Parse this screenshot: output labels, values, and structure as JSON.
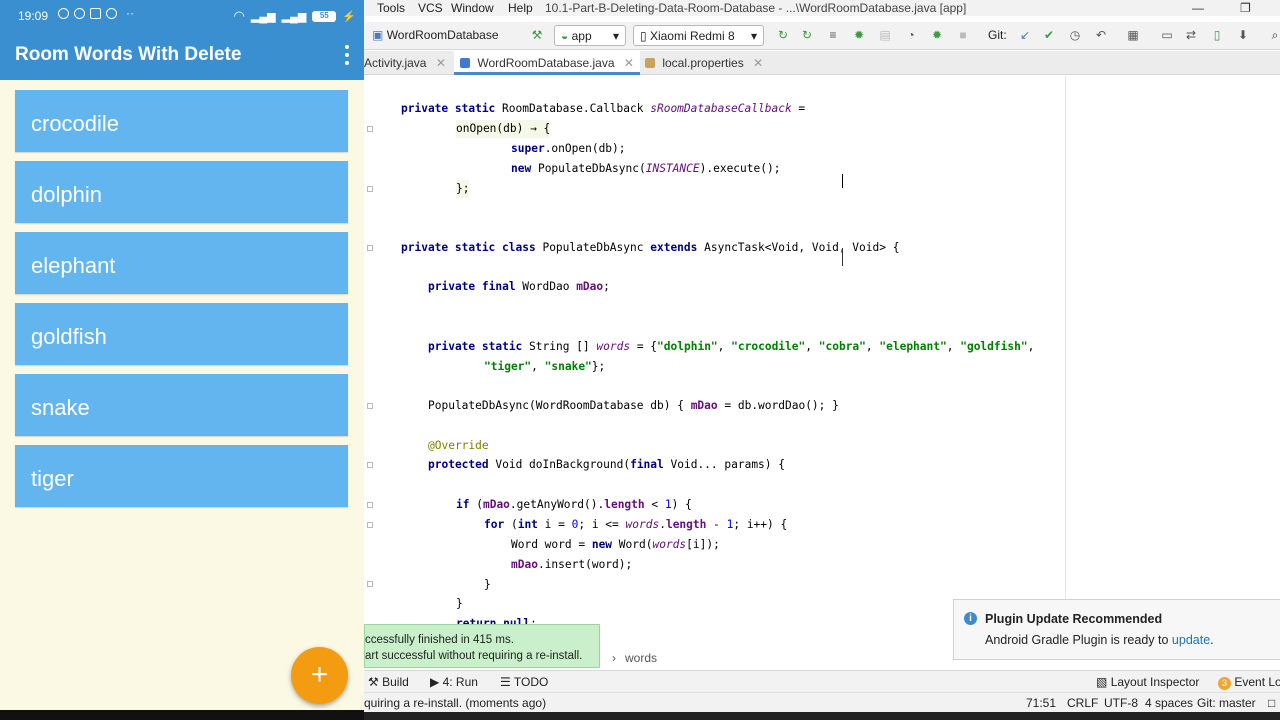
{
  "phone": {
    "status_time": "19:09",
    "status_dots": "··",
    "battery": "55",
    "app_title": "Room Words With Delete",
    "words": [
      "crocodile",
      "dolphin",
      "elephant",
      "goldfish",
      "snake",
      "tiger"
    ],
    "fab_label": "+",
    "colors": {
      "app_bar": "#3a8fd1",
      "list_item": "#63b5f0",
      "background": "#fbf8e4",
      "fab": "#f39c12"
    }
  },
  "ide": {
    "menu": [
      "Tools",
      "VCS",
      "Window",
      "Help"
    ],
    "window_title": "10.1-Part-B-Deleting-Data-Room-Database - ...\\WordRoomDatabase.java [app]",
    "toolbar": {
      "crumb": "WordRoomDatabase",
      "run_config": "app",
      "device": "Xiaomi Redmi 8",
      "git_label": "Git:"
    },
    "tabs": [
      {
        "label": "Activity.java",
        "active": false
      },
      {
        "label": "WordRoomDatabase.java",
        "active": true
      },
      {
        "label": "local.properties",
        "active": false
      }
    ],
    "code": {
      "l1_a": "private static ",
      "l1_b": "RoomDatabase.Callback ",
      "l1_c": "sRoomDatabaseCallback",
      "l1_d": " =",
      "l2": "onOpen(db) → {",
      "l3_a": "super",
      "l3_b": ".onOpen(db);",
      "l4_a": "new ",
      "l4_b": "PopulateDbAsync(",
      "l4_c": "INSTANCE",
      "l4_d": ").execute();",
      "l5": "};",
      "l6_a": "private static class ",
      "l6_b": "PopulateDbAsync ",
      "l6_c": "extends ",
      "l6_d": "AsyncTask<Void, Void, Void> {",
      "l7_a": "private final ",
      "l7_b": "WordDao ",
      "l7_c": "mDao",
      "l7_d": ";",
      "l8_a": "private static ",
      "l8_b": "String [] ",
      "l8_c": "words",
      "l8_d": " = {",
      "l8_s1": "\"dolphin\"",
      "l8_s2": "\"crocodile\"",
      "l8_s3": "\"cobra\"",
      "l8_s4": "\"elephant\"",
      "l8_s5": "\"goldfish\"",
      "l8_sep": ", ",
      "l9_s1": "\"tiger\"",
      "l9_s2": "\"snake\"",
      "l9_end": "};",
      "l10_a": "PopulateDbAsync(WordRoomDatabase db) { ",
      "l10_b": "mDao",
      "l10_c": " = db.wordDao(); }",
      "l11": "@Override",
      "l12_a": "protected ",
      "l12_b": "Void doInBackground(",
      "l12_c": "final ",
      "l12_d": "Void... params) {",
      "l13_a": "if ",
      "l13_b": "(",
      "l13_c": "mDao",
      "l13_d": ".getAnyWord().",
      "l13_e": "length",
      "l13_f": " < ",
      "l13_g": "1",
      "l13_h": ") {",
      "l14_a": "for ",
      "l14_b": "(",
      "l14_c": "int ",
      "l14_d": "i = ",
      "l14_e": "0",
      "l14_f": "; i <= ",
      "l14_g": "words",
      "l14_h": ".",
      "l14_i": "length",
      "l14_j": " - ",
      "l14_k": "1",
      "l14_l": "; i++) {",
      "l15_a": "Word word = ",
      "l15_b": "new ",
      "l15_c": "Word(",
      "l15_d": "words",
      "l15_e": "[i]);",
      "l16_a": "mDao",
      "l16_b": ".insert(word);",
      "l17": "}",
      "l18": "}",
      "l19_a": "return null",
      "l19_b": ";"
    },
    "run_popup": {
      "line1": "ccessfully finished in 415 ms.",
      "line2": "art successful without requiring a re-install."
    },
    "plugin_popup": {
      "title": "Plugin Update Recommended",
      "body": "Android Gradle Plugin is ready to ",
      "link": "update",
      "end": "."
    },
    "breadcrumb": "words",
    "bottom_tools": {
      "build": "Build",
      "run": "4: Run",
      "todo": "TODO",
      "layout_inspector": "Layout Inspector",
      "event_log_count": "3",
      "event_log": "Event Log"
    },
    "status": {
      "message": "quiring a re-install. (moments ago)",
      "position": "71:51",
      "line_sep": "CRLF",
      "encoding": "UTF-8",
      "indent": "4 spaces",
      "git_branch": "Git: master"
    },
    "colors": {
      "keyword": "#000080",
      "string": "#008000",
      "field": "#660e7a",
      "annotation": "#808000",
      "link": "#2470b3",
      "tab_active": "#4a88c7"
    }
  }
}
